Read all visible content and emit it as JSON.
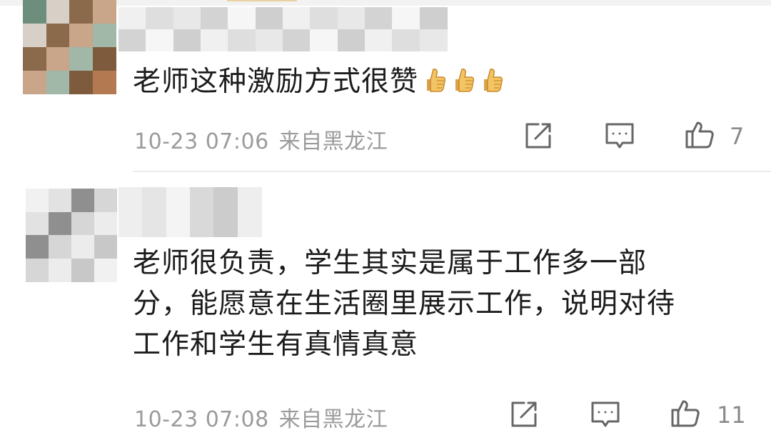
{
  "comments": [
    {
      "text": "老师这种激励方式很赞",
      "emoji_icon": "thumbs-up-emoji",
      "emoji_count": 3,
      "time": "10-23 07:06",
      "location": "来自黑龙江",
      "likes": "7"
    },
    {
      "text_lines": [
        "老师很负责，学生其实是属于工作多一部",
        "分，能愿意在生活圈里展示工作，说明对待",
        "工作和学生有真情真意"
      ],
      "time": "10-23 07:08",
      "location": "来自黑龙江",
      "likes": "11"
    }
  ],
  "icons": {
    "share": "share-icon",
    "comment": "comment-icon",
    "like": "thumbs-up-icon"
  },
  "colors": {
    "meta_text": "#9b9b9b",
    "body_text": "#1c1c1c",
    "icon": "#666666",
    "divider": "#ececec"
  }
}
